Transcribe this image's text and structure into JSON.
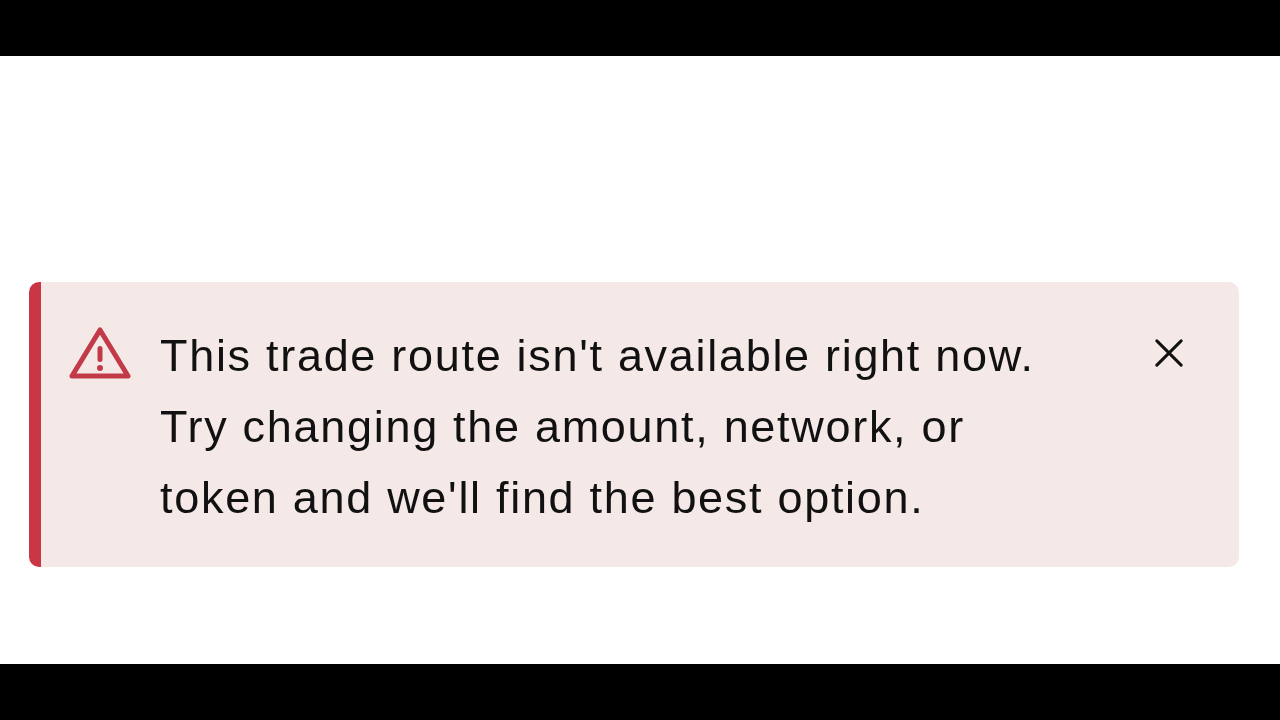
{
  "alert": {
    "error": true,
    "title": "This trade route isn't available right now.",
    "message": "Try changing the amount, network, or token and we'll find the best option.",
    "dismissible": true
  }
}
